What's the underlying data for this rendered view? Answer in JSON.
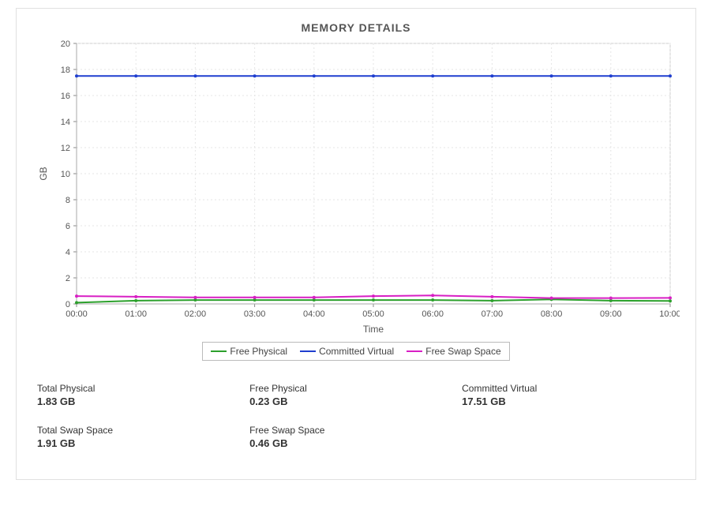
{
  "title": "MEMORY DETAILS",
  "chart_data": {
    "type": "line",
    "title": "MEMORY DETAILS",
    "xlabel": "Time",
    "ylabel": "GB",
    "ylim": [
      0,
      20
    ],
    "yticks": [
      0,
      2,
      4,
      6,
      8,
      10,
      12,
      14,
      16,
      18,
      20
    ],
    "categories": [
      "00:00",
      "01:00",
      "02:00",
      "03:00",
      "04:00",
      "05:00",
      "06:00",
      "07:00",
      "08:00",
      "09:00",
      "10:00"
    ],
    "series": [
      {
        "name": "Free Physical",
        "color": "#2ca02c",
        "values": [
          0.1,
          0.25,
          0.3,
          0.3,
          0.3,
          0.3,
          0.3,
          0.25,
          0.35,
          0.25,
          0.23
        ]
      },
      {
        "name": "Committed Virtual",
        "color": "#1f3ecf",
        "values": [
          17.5,
          17.5,
          17.5,
          17.5,
          17.5,
          17.5,
          17.5,
          17.5,
          17.5,
          17.5,
          17.5
        ]
      },
      {
        "name": "Free Swap Space",
        "color": "#d81fc4",
        "values": [
          0.6,
          0.55,
          0.5,
          0.5,
          0.5,
          0.6,
          0.65,
          0.55,
          0.45,
          0.45,
          0.46
        ]
      }
    ]
  },
  "stats": {
    "row1": [
      {
        "label": "Total Physical",
        "value": "1.83 GB"
      },
      {
        "label": "Free Physical",
        "value": "0.23 GB"
      },
      {
        "label": "Committed Virtual",
        "value": "17.51 GB"
      }
    ],
    "row2": [
      {
        "label": "Total Swap Space",
        "value": "1.91 GB"
      },
      {
        "label": "Free Swap Space",
        "value": "0.46 GB"
      }
    ]
  }
}
